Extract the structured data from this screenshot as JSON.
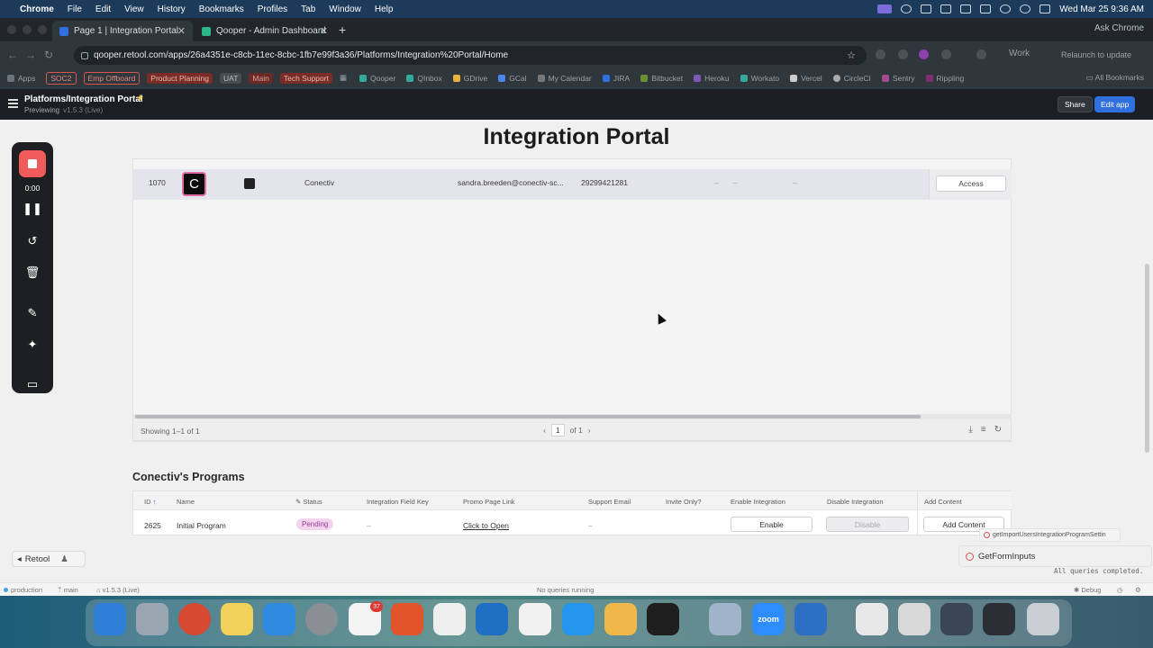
{
  "menubar": {
    "app": "Chrome",
    "items": [
      "File",
      "Edit",
      "View",
      "History",
      "Bookmarks",
      "Profiles",
      "Tab",
      "Window",
      "Help"
    ],
    "datetime": "Wed Mar 25  9:36 AM"
  },
  "browser": {
    "tabs": [
      {
        "title": "Page 1 | Integration Portal",
        "favicon_color": "#2f6fde"
      },
      {
        "title": "Qooper - Admin Dashboard",
        "favicon_color": "#2fb58a"
      }
    ],
    "ask_chrome": "Ask Chrome",
    "url": "qooper.retool.com/apps/26a4351e-c8cb-11ec-8cbc-1fb7e99f3a36/Platforms/Integration%20Portal/Home",
    "profile": "Work",
    "relaunch": "Relaunch to update",
    "bookmarks": [
      {
        "label": "Apps",
        "type": "plain"
      },
      {
        "label": "SOC2",
        "type": "tag",
        "color": "#d9534f"
      },
      {
        "label": "Emp Offboard",
        "type": "tag",
        "color": "#d9534f"
      },
      {
        "label": "Product Planning",
        "type": "tag",
        "color": "#c0392b"
      },
      {
        "label": "UAT",
        "type": "tag",
        "color": "#6b747b"
      },
      {
        "label": "Main",
        "type": "tag",
        "color": "#a33"
      },
      {
        "label": "Tech Support",
        "type": "tag",
        "color": "#c0392b"
      },
      {
        "label": "Qooper",
        "type": "plain"
      },
      {
        "label": "QInbox",
        "type": "plain"
      },
      {
        "label": "GDrive",
        "type": "plain"
      },
      {
        "label": "GCal",
        "type": "plain"
      },
      {
        "label": "My Calendar",
        "type": "plain"
      },
      {
        "label": "JIRA",
        "type": "plain"
      },
      {
        "label": "Bitbucket",
        "type": "plain"
      },
      {
        "label": "Heroku",
        "type": "plain"
      },
      {
        "label": "Workato",
        "type": "plain"
      },
      {
        "label": "Vercel",
        "type": "plain"
      },
      {
        "label": "CircleCI",
        "type": "plain"
      },
      {
        "label": "Sentry",
        "type": "plain"
      },
      {
        "label": "Rippling",
        "type": "plain"
      }
    ],
    "all_bookmarks": "All Bookmarks"
  },
  "retool_header": {
    "title": "Platforms/Integration Portal",
    "mode": "Previewing",
    "version": "v1.5.3 (Live)",
    "share_label": "Share",
    "edit_label": "Edit app"
  },
  "page": {
    "title": "Integration Portal"
  },
  "clients_table": {
    "row": {
      "id": "1070",
      "logo_letter": "C",
      "name": "Conectiv",
      "email": "sandra.breeden@conectiv-sc...",
      "phone": "29299421281",
      "dash1": "–",
      "dash2": "–",
      "dash3": "–",
      "action": "Access"
    },
    "showing": "Showing 1–1 of 1",
    "page_current": "1",
    "page_of": "of 1"
  },
  "programs": {
    "title": "Conectiv's Programs",
    "headers": {
      "id": "ID",
      "name": "Name",
      "status": "Status",
      "field_key": "Integration Field Key",
      "promo": "Promo Page Link",
      "support": "Support Email",
      "invite": "Invite Only?",
      "enable": "Enable Integration",
      "disable": "Disable Integration",
      "add": "Add Content"
    },
    "row": {
      "id": "2625",
      "name": "Initial Program",
      "status": "Pending",
      "field_key": "–",
      "promo": "Click to Open",
      "support": "–",
      "enable": "Enable",
      "disable": "Disable",
      "add": "Add Content"
    }
  },
  "notifications": {
    "query_small": "getImportUsersIntegrationProgramSettin",
    "query_error": "GetFormInputs",
    "all_complete": "All queries completed."
  },
  "recorder": {
    "time": "0:00"
  },
  "retool_badge": "Retool",
  "statusbar": {
    "env": "production",
    "branch": "main",
    "version": "v1.5.3 (Live)",
    "queries": "No queries running",
    "debug": "Debug"
  },
  "dock": {
    "slack_badge": "37",
    "zoom_label": "zoom"
  }
}
